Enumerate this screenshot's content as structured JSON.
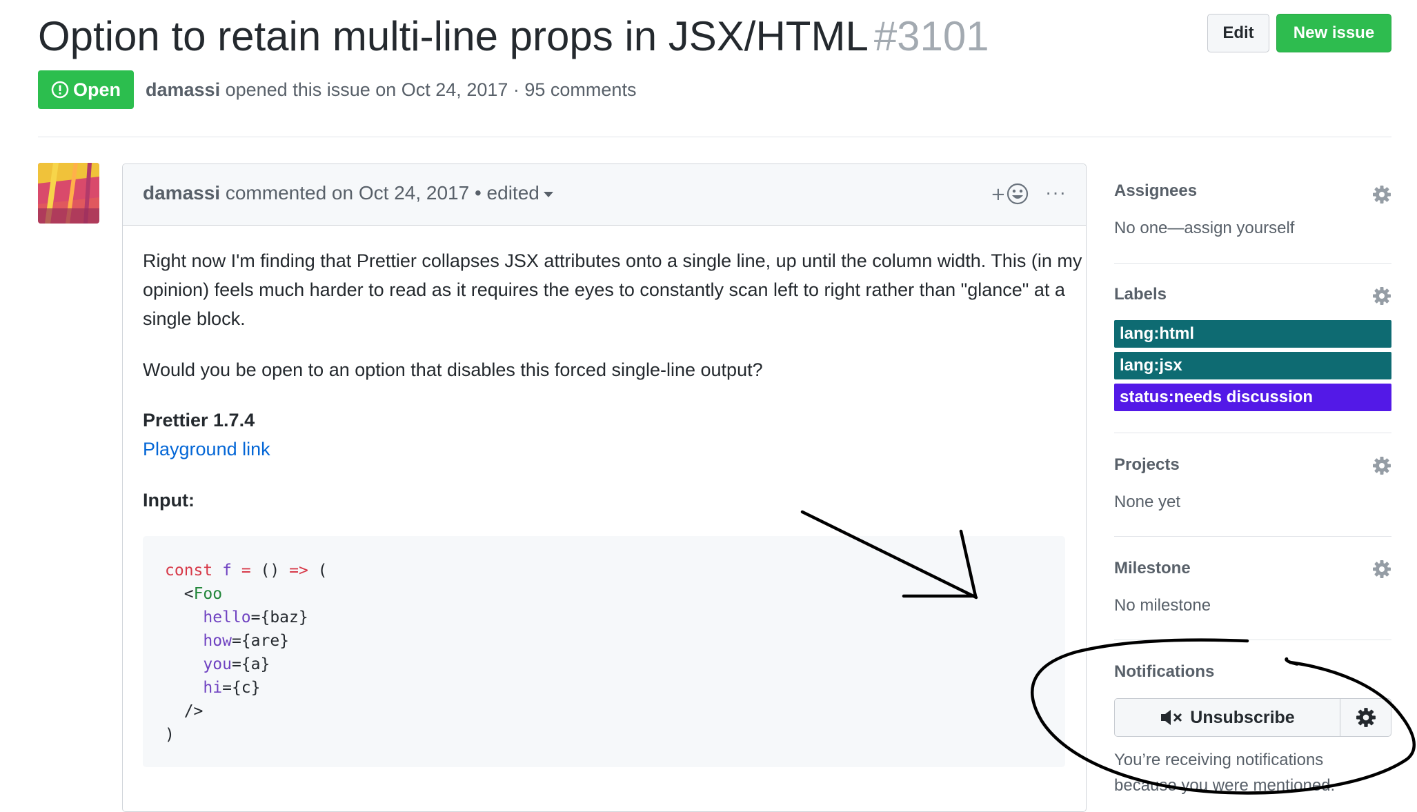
{
  "issue": {
    "title": "Option to retain multi-line props in JSX/HTML",
    "number": "#3101",
    "state": "Open",
    "author": "damassi",
    "meta_rest": "opened this issue on Oct 24, 2017 · 95 comments"
  },
  "header_buttons": {
    "edit": "Edit",
    "new_issue": "New issue"
  },
  "comment": {
    "author": "damassi",
    "meta": "commented on Oct 24, 2017 • edited",
    "reaction_plus": "+",
    "more": "···",
    "paragraph1": "Right now I'm finding that Prettier collapses JSX attributes onto a single line, up until the column width. This (in my opinion) feels much harder to read as it requires the eyes to constantly scan left to right rather than \"glance\" at a single block.",
    "paragraph2": "Would you be open to an option that disables this forced single-line output?",
    "version_heading": "Prettier 1.7.4",
    "playground_link": "Playground link",
    "input_heading": "Input:",
    "code": {
      "l1_const": "const",
      "l1_f": "f",
      "l1_eq": "=",
      "l1_paren": "()",
      "l1_arrow": "=>",
      "l1_open": "(",
      "l2_lt": "<",
      "l2_tag": "Foo",
      "l3_attr": "hello",
      "l3_val": "={baz}",
      "l4_attr": "how",
      "l4_val": "={are}",
      "l5_attr": "you",
      "l5_val": "={a}",
      "l6_attr": "hi",
      "l6_val": "={c}",
      "l7": "/>",
      "l8": ")"
    }
  },
  "sidebar": {
    "assignees": {
      "heading": "Assignees",
      "text": "No one—assign yourself"
    },
    "labels": {
      "heading": "Labels",
      "items": [
        {
          "name": "lang:html",
          "color": "#0e6b72"
        },
        {
          "name": "lang:jsx",
          "color": "#0e6b72"
        },
        {
          "name": "status:needs discussion",
          "color": "#5319e7"
        }
      ]
    },
    "projects": {
      "heading": "Projects",
      "text": "None yet"
    },
    "milestone": {
      "heading": "Milestone",
      "text": "No milestone"
    },
    "notifications": {
      "heading": "Notifications",
      "button": "Unsubscribe",
      "reason_line1": "You’re receiving notifications",
      "reason_line2": "because you were mentioned."
    }
  },
  "colors": {
    "open_green": "#2cbe4e",
    "new_issue_green": "#2ebc4f",
    "link_blue": "#0366d6",
    "annotation_ink": "#000000"
  }
}
